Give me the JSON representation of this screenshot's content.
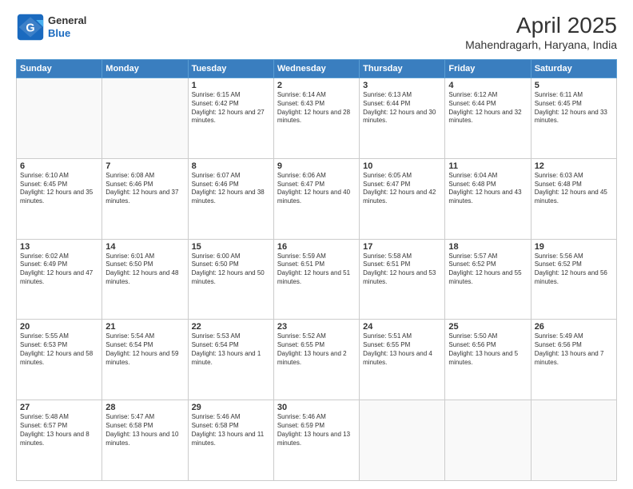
{
  "header": {
    "logo_general": "General",
    "logo_blue": "Blue",
    "title": "April 2025",
    "subtitle": "Mahendragarh, Haryana, India"
  },
  "days_of_week": [
    "Sunday",
    "Monday",
    "Tuesday",
    "Wednesday",
    "Thursday",
    "Friday",
    "Saturday"
  ],
  "weeks": [
    [
      {
        "day": "",
        "info": ""
      },
      {
        "day": "",
        "info": ""
      },
      {
        "day": "1",
        "info": "Sunrise: 6:15 AM\nSunset: 6:42 PM\nDaylight: 12 hours and 27 minutes."
      },
      {
        "day": "2",
        "info": "Sunrise: 6:14 AM\nSunset: 6:43 PM\nDaylight: 12 hours and 28 minutes."
      },
      {
        "day": "3",
        "info": "Sunrise: 6:13 AM\nSunset: 6:44 PM\nDaylight: 12 hours and 30 minutes."
      },
      {
        "day": "4",
        "info": "Sunrise: 6:12 AM\nSunset: 6:44 PM\nDaylight: 12 hours and 32 minutes."
      },
      {
        "day": "5",
        "info": "Sunrise: 6:11 AM\nSunset: 6:45 PM\nDaylight: 12 hours and 33 minutes."
      }
    ],
    [
      {
        "day": "6",
        "info": "Sunrise: 6:10 AM\nSunset: 6:45 PM\nDaylight: 12 hours and 35 minutes."
      },
      {
        "day": "7",
        "info": "Sunrise: 6:08 AM\nSunset: 6:46 PM\nDaylight: 12 hours and 37 minutes."
      },
      {
        "day": "8",
        "info": "Sunrise: 6:07 AM\nSunset: 6:46 PM\nDaylight: 12 hours and 38 minutes."
      },
      {
        "day": "9",
        "info": "Sunrise: 6:06 AM\nSunset: 6:47 PM\nDaylight: 12 hours and 40 minutes."
      },
      {
        "day": "10",
        "info": "Sunrise: 6:05 AM\nSunset: 6:47 PM\nDaylight: 12 hours and 42 minutes."
      },
      {
        "day": "11",
        "info": "Sunrise: 6:04 AM\nSunset: 6:48 PM\nDaylight: 12 hours and 43 minutes."
      },
      {
        "day": "12",
        "info": "Sunrise: 6:03 AM\nSunset: 6:48 PM\nDaylight: 12 hours and 45 minutes."
      }
    ],
    [
      {
        "day": "13",
        "info": "Sunrise: 6:02 AM\nSunset: 6:49 PM\nDaylight: 12 hours and 47 minutes."
      },
      {
        "day": "14",
        "info": "Sunrise: 6:01 AM\nSunset: 6:50 PM\nDaylight: 12 hours and 48 minutes."
      },
      {
        "day": "15",
        "info": "Sunrise: 6:00 AM\nSunset: 6:50 PM\nDaylight: 12 hours and 50 minutes."
      },
      {
        "day": "16",
        "info": "Sunrise: 5:59 AM\nSunset: 6:51 PM\nDaylight: 12 hours and 51 minutes."
      },
      {
        "day": "17",
        "info": "Sunrise: 5:58 AM\nSunset: 6:51 PM\nDaylight: 12 hours and 53 minutes."
      },
      {
        "day": "18",
        "info": "Sunrise: 5:57 AM\nSunset: 6:52 PM\nDaylight: 12 hours and 55 minutes."
      },
      {
        "day": "19",
        "info": "Sunrise: 5:56 AM\nSunset: 6:52 PM\nDaylight: 12 hours and 56 minutes."
      }
    ],
    [
      {
        "day": "20",
        "info": "Sunrise: 5:55 AM\nSunset: 6:53 PM\nDaylight: 12 hours and 58 minutes."
      },
      {
        "day": "21",
        "info": "Sunrise: 5:54 AM\nSunset: 6:54 PM\nDaylight: 12 hours and 59 minutes."
      },
      {
        "day": "22",
        "info": "Sunrise: 5:53 AM\nSunset: 6:54 PM\nDaylight: 13 hours and 1 minute."
      },
      {
        "day": "23",
        "info": "Sunrise: 5:52 AM\nSunset: 6:55 PM\nDaylight: 13 hours and 2 minutes."
      },
      {
        "day": "24",
        "info": "Sunrise: 5:51 AM\nSunset: 6:55 PM\nDaylight: 13 hours and 4 minutes."
      },
      {
        "day": "25",
        "info": "Sunrise: 5:50 AM\nSunset: 6:56 PM\nDaylight: 13 hours and 5 minutes."
      },
      {
        "day": "26",
        "info": "Sunrise: 5:49 AM\nSunset: 6:56 PM\nDaylight: 13 hours and 7 minutes."
      }
    ],
    [
      {
        "day": "27",
        "info": "Sunrise: 5:48 AM\nSunset: 6:57 PM\nDaylight: 13 hours and 8 minutes."
      },
      {
        "day": "28",
        "info": "Sunrise: 5:47 AM\nSunset: 6:58 PM\nDaylight: 13 hours and 10 minutes."
      },
      {
        "day": "29",
        "info": "Sunrise: 5:46 AM\nSunset: 6:58 PM\nDaylight: 13 hours and 11 minutes."
      },
      {
        "day": "30",
        "info": "Sunrise: 5:46 AM\nSunset: 6:59 PM\nDaylight: 13 hours and 13 minutes."
      },
      {
        "day": "",
        "info": ""
      },
      {
        "day": "",
        "info": ""
      },
      {
        "day": "",
        "info": ""
      }
    ]
  ]
}
